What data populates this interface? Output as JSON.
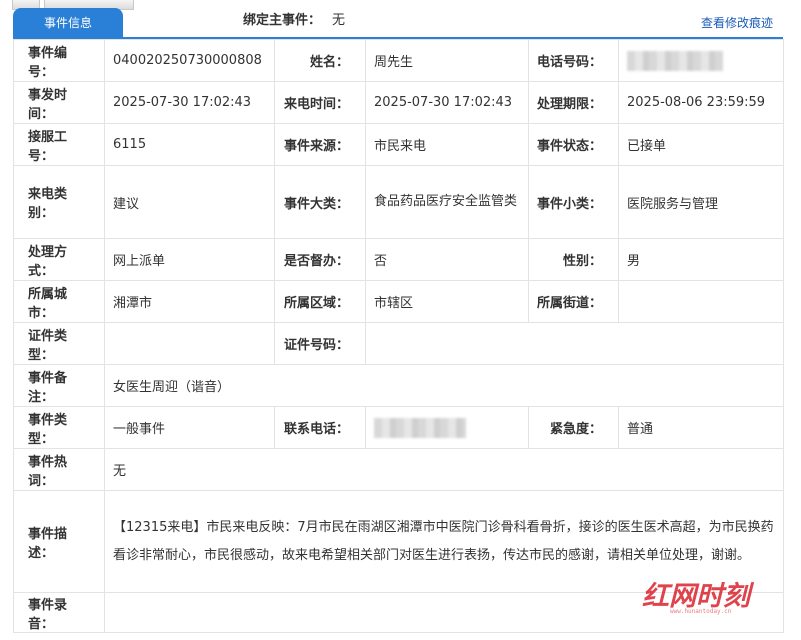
{
  "header": {
    "tab_label": "事件信息",
    "bind_main_label": "绑定主事件：",
    "bind_main_value": "无",
    "modify_link": "查看修改痕迹"
  },
  "fields": {
    "event_no": {
      "label": "事件编号：",
      "value": "040020250730000808"
    },
    "name": {
      "label": "姓名：",
      "value": "周先生"
    },
    "phone": {
      "label": "电话号码：",
      "value": ""
    },
    "occur_time": {
      "label": "事发时间：",
      "value": "2025-07-30 17:02:43"
    },
    "call_time": {
      "label": "来电时间：",
      "value": "2025-07-30 17:02:43"
    },
    "deadline": {
      "label": "处理期限：",
      "value": "2025-08-06 23:59:59"
    },
    "agent_no": {
      "label": "接服工号：",
      "value": "6115"
    },
    "source": {
      "label": "事件来源：",
      "value": "市民来电"
    },
    "status": {
      "label": "事件状态：",
      "value": "已接单"
    },
    "call_type": {
      "label": "来电类别：",
      "value": "建议"
    },
    "major_cat": {
      "label": "事件大类：",
      "value": "食品药品医疗安全监管类"
    },
    "minor_cat": {
      "label": "事件小类：",
      "value": "医院服务与管理"
    },
    "handle_way": {
      "label": "处理方式：",
      "value": "网上派单"
    },
    "supervise": {
      "label": "是否督办：",
      "value": "否"
    },
    "gender": {
      "label": "性别：",
      "value": "男"
    },
    "city": {
      "label": "所属城市：",
      "value": "湘潭市"
    },
    "district": {
      "label": "所属区域：",
      "value": "市辖区"
    },
    "street": {
      "label": "所属街道：",
      "value": ""
    },
    "id_type": {
      "label": "证件类型：",
      "value": ""
    },
    "id_no": {
      "label": "证件号码：",
      "value": ""
    },
    "remark": {
      "label": "事件备注：",
      "value": "女医生周迎（谐音）"
    },
    "event_type": {
      "label": "事件类型：",
      "value": "一般事件"
    },
    "contact_phone": {
      "label": "联系电话：",
      "value": ""
    },
    "urgency": {
      "label": "紧急度：",
      "value": "普通"
    },
    "hot_word": {
      "label": "事件热词：",
      "value": "无"
    },
    "description": {
      "label": "事件描述：",
      "value": "【12315来电】市民来电反映：7月市民在雨湖区湘潭市中医院门诊骨科看骨折，接诊的医生医术高超，为市民换药看诊非常耐心，市民很感动，故来电希望相关部门对医生进行表扬，传达市民的感谢，请相关单位处理，谢谢。"
    },
    "recording": {
      "label": "事件录音：",
      "value": ""
    }
  },
  "watermark": {
    "text": "红网时刻"
  },
  "colors": {
    "accent": "#2a7fd6",
    "link": "#1a5bb8",
    "border": "#e3e3e3",
    "watermark": "#d9232d"
  }
}
